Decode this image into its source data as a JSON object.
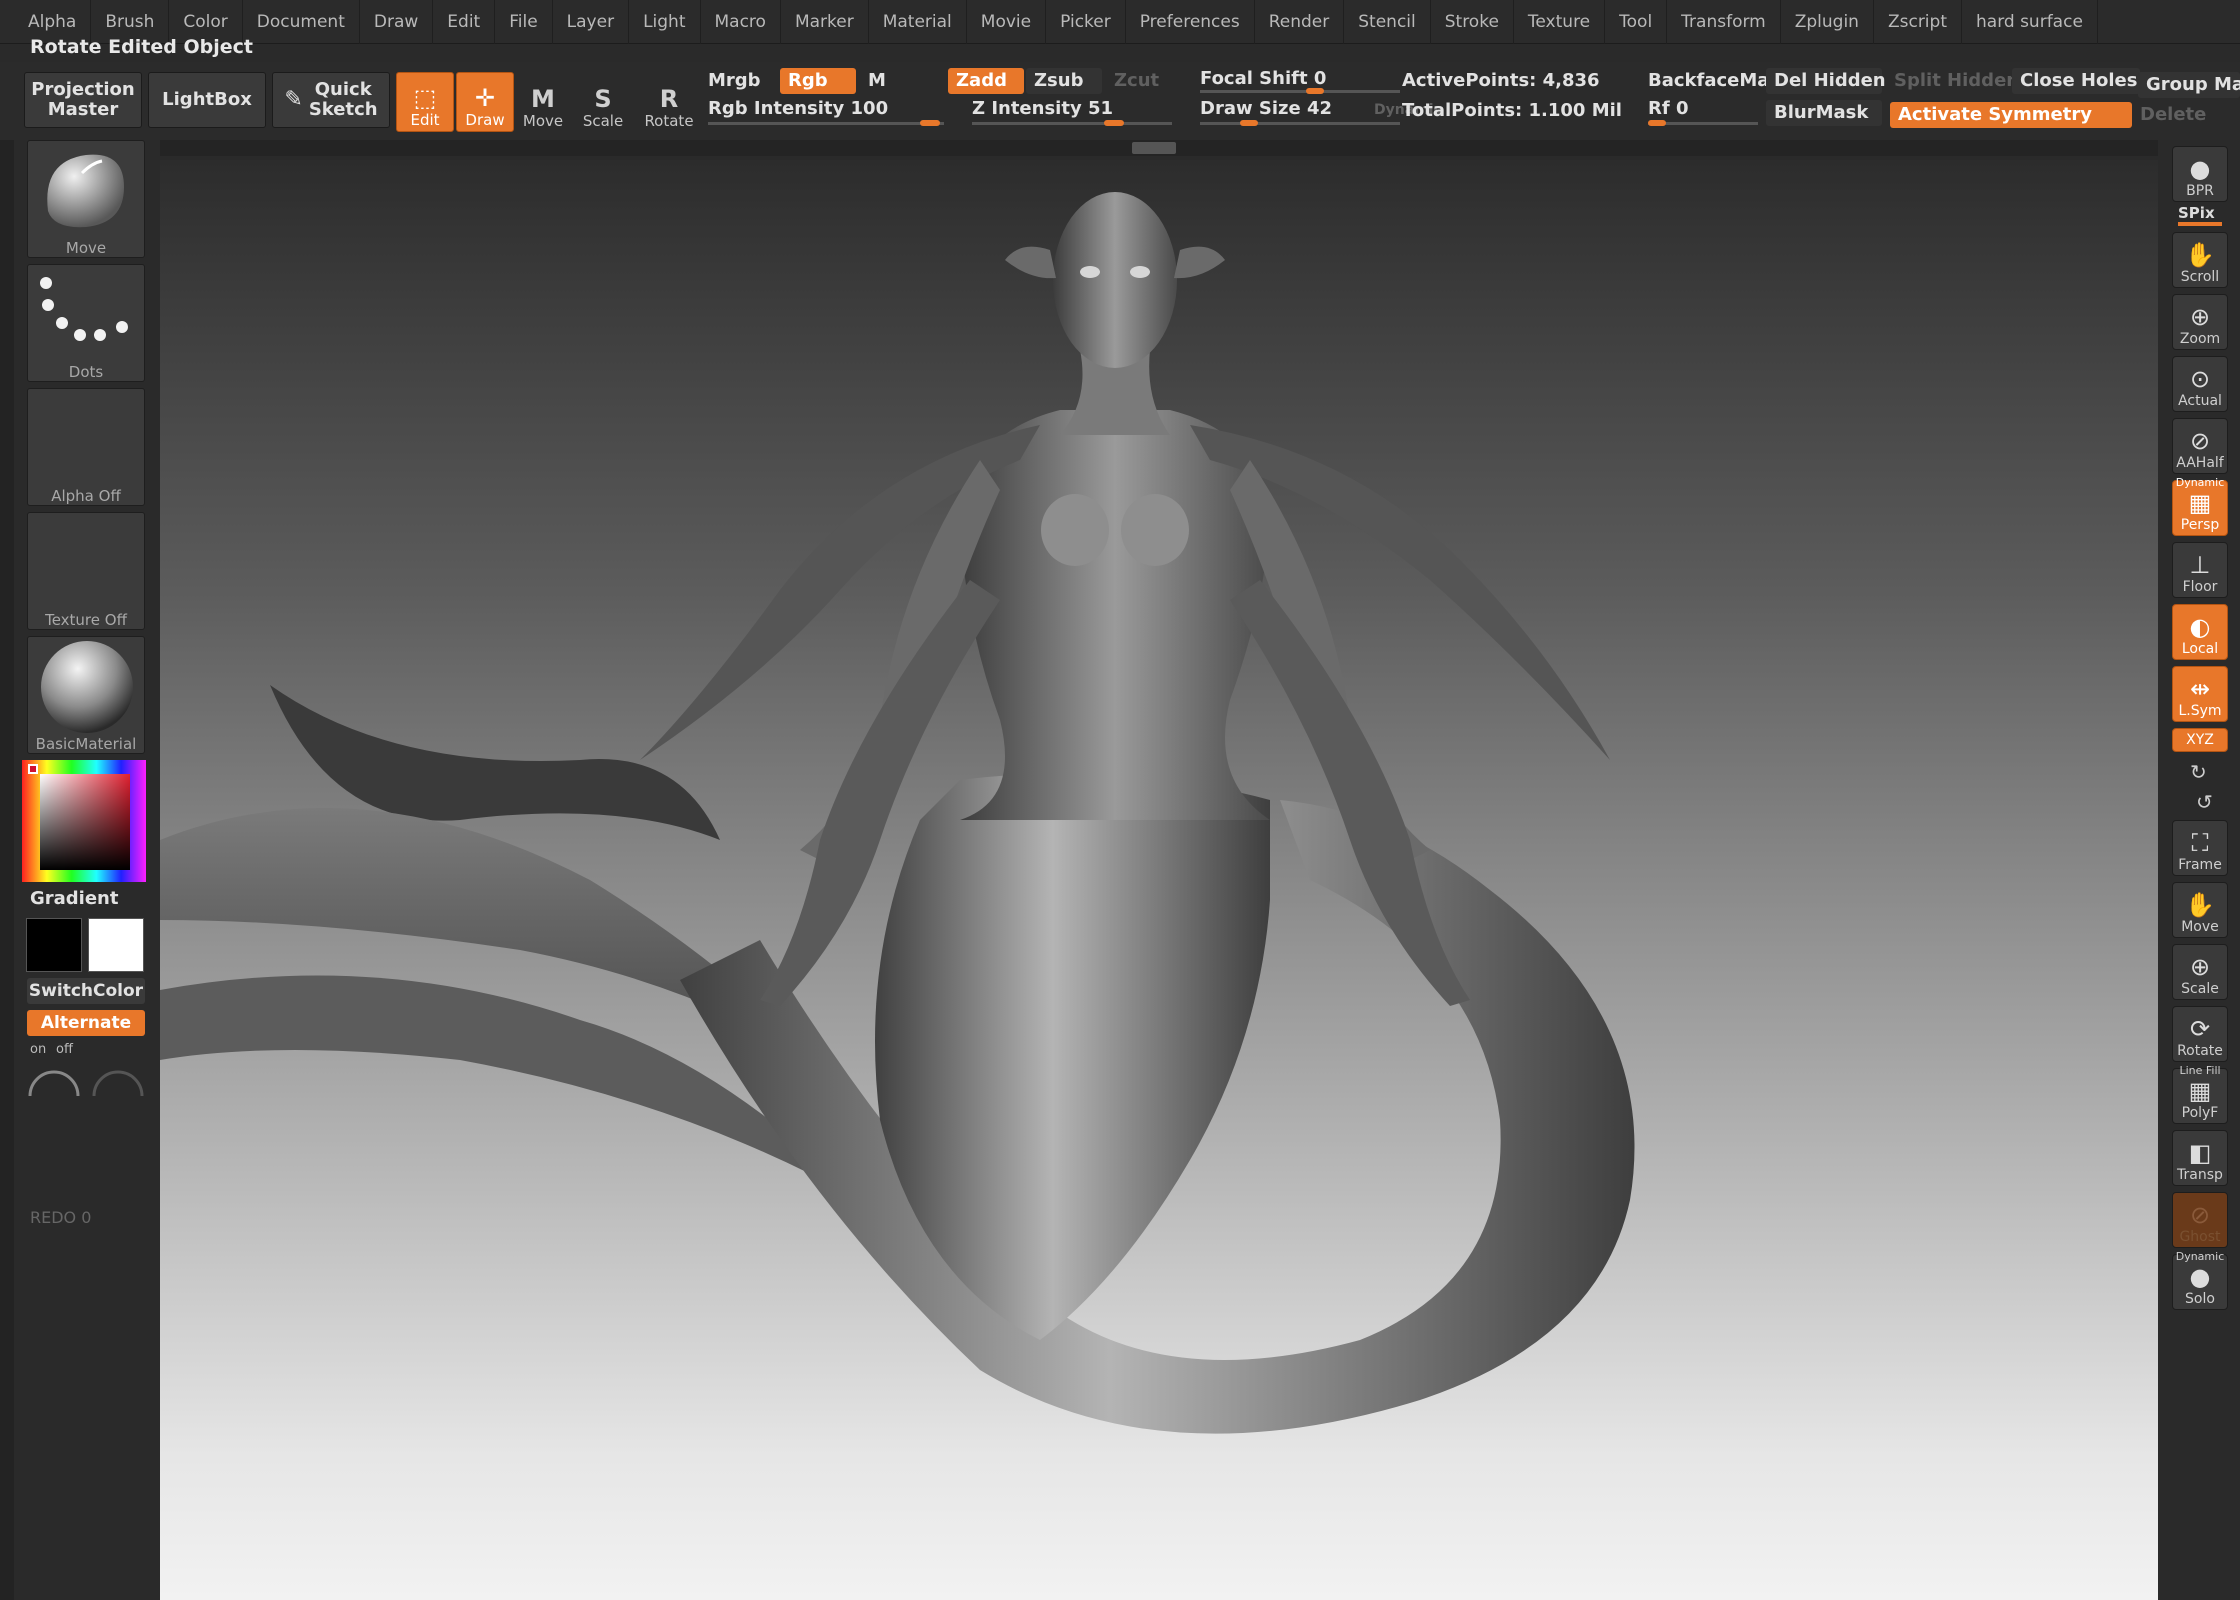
{
  "menubar": {
    "items": [
      "Alpha",
      "Brush",
      "Color",
      "Document",
      "Draw",
      "Edit",
      "File",
      "Layer",
      "Light",
      "Macro",
      "Marker",
      "Material",
      "Movie",
      "Picker",
      "Preferences",
      "Render",
      "Stencil",
      "Stroke",
      "Texture",
      "Tool",
      "Transform",
      "Zplugin",
      "Zscript",
      "hard surface"
    ]
  },
  "status": {
    "text": "Rotate Edited Object"
  },
  "toolbar": {
    "projection_master": "Projection\nMaster",
    "lightbox": "LightBox",
    "quick_sketch": "Quick\nSketch",
    "edit": "Edit",
    "draw": "Draw",
    "move": "Move",
    "scale": "Scale",
    "rotate": "Rotate",
    "mrgb": "Mrgb",
    "rgb": "Rgb",
    "m": "M",
    "rgb_intensity": "Rgb Intensity 100",
    "zadd": "Zadd",
    "zsub": "Zsub",
    "zcut": "Zcut",
    "z_intensity": "Z Intensity 51",
    "focal_shift": "Focal Shift 0",
    "draw_size": "Draw Size 42",
    "dynamic": "Dynamic",
    "active_points": "ActivePoints: 4,836",
    "total_points": "TotalPoints: 1.100 Mil",
    "backface": "BackfaceMa:",
    "rf": "Rf 0",
    "del_hidden": "Del Hidden",
    "split_hidden": "Split Hidden",
    "close_holes": "Close Holes",
    "group_ma": "Group Ma",
    "blurmask": "BlurMask",
    "activate_symmetry": "Activate Symmetry",
    "delete": "Delete"
  },
  "left_shelf": {
    "brush": "Move",
    "stroke": "Dots",
    "alpha": "Alpha Off",
    "texture": "Texture Off",
    "material": "BasicMaterial",
    "gradient": "Gradient",
    "switch_color": "SwitchColor",
    "alternate": "Alternate",
    "on": "on",
    "off": "off",
    "redo": "REDO 0"
  },
  "right_shelf": {
    "bpr": "BPR",
    "spix": "SPix",
    "scroll": "Scroll",
    "zoom": "Zoom",
    "actual": "Actual",
    "aahalf": "AAHalf",
    "dynamic": "Dynamic",
    "persp": "Persp",
    "floor": "Floor",
    "local": "Local",
    "lsym": "L.Sym",
    "xyz": "XYZ",
    "frame": "Frame",
    "move": "Move",
    "scale": "Scale",
    "rotate": "Rotate",
    "line_fill": "Line Fill",
    "polyf": "PolyF",
    "transp": "Transp",
    "ghost": "Ghost",
    "dynamic2": "Dynamic",
    "solo": "Solo"
  },
  "colors": {
    "accent": "#e8772a",
    "panel": "#2b2b2b"
  }
}
